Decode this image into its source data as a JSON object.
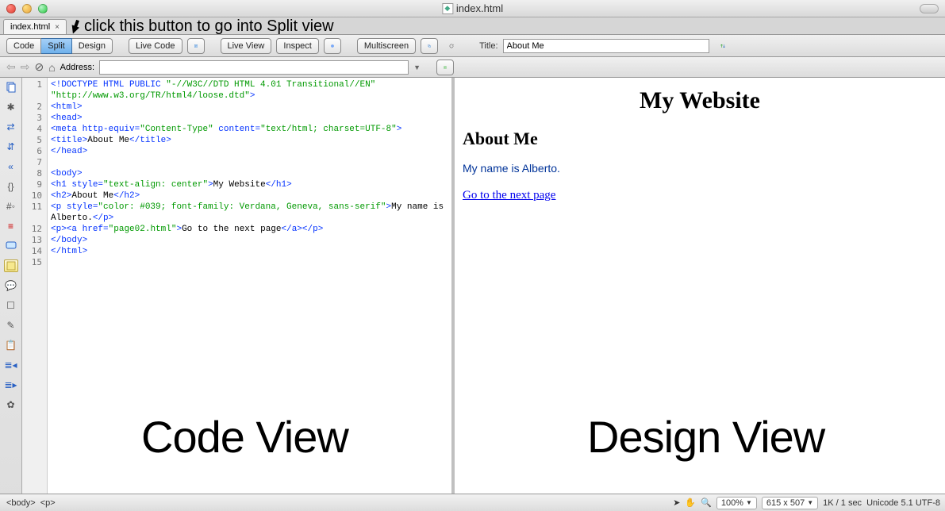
{
  "window": {
    "title": "index.html"
  },
  "tab": {
    "name": "index.html"
  },
  "annotation": {
    "text": "click this button to go into Split view"
  },
  "toolbar": {
    "view_buttons": {
      "code": "Code",
      "split": "Split",
      "design": "Design"
    },
    "live_code": "Live Code",
    "live_view": "Live View",
    "inspect": "Inspect",
    "multiscreen": "Multiscreen",
    "title_label": "Title:",
    "title_value": "About Me"
  },
  "address_bar": {
    "label": "Address:",
    "value": ""
  },
  "code": {
    "lines": [
      {
        "n": "1",
        "html": "<span class='c-tag'>&lt;!DOCTYPE HTML PUBLIC </span><span class='c-val'>\"-//W3C//DTD HTML 4.01 Transitional//EN\"</span>"
      },
      {
        "n": "",
        "html": "<span class='c-val'>\"http://www.w3.org/TR/html4/loose.dtd\"</span><span class='c-tag'>&gt;</span>"
      },
      {
        "n": "2",
        "html": "<span class='c-tag'>&lt;html&gt;</span>"
      },
      {
        "n": "3",
        "html": "<span class='c-tag'>&lt;head&gt;</span>"
      },
      {
        "n": "4",
        "html": "<span class='c-tag'>&lt;meta</span> <span class='c-attr'>http-equiv=</span><span class='c-val'>\"Content-Type\"</span> <span class='c-attr'>content=</span><span class='c-val'>\"text/html; charset=UTF-8\"</span><span class='c-tag'>&gt;</span>"
      },
      {
        "n": "5",
        "html": "<span class='c-tag'>&lt;title&gt;</span>About Me<span class='c-tag'>&lt;/title&gt;</span>"
      },
      {
        "n": "6",
        "html": "<span class='c-tag'>&lt;/head&gt;</span>"
      },
      {
        "n": "7",
        "html": ""
      },
      {
        "n": "8",
        "html": "<span class='c-tag'>&lt;body&gt;</span>"
      },
      {
        "n": "9",
        "html": "<span class='c-tag'>&lt;h1</span> <span class='c-attr'>style=</span><span class='c-val'>\"text-align: center\"</span><span class='c-tag'>&gt;</span>My Website<span class='c-tag'>&lt;/h1&gt;</span>"
      },
      {
        "n": "10",
        "html": "<span class='c-tag'>&lt;h2&gt;</span>About Me<span class='c-tag'>&lt;/h2&gt;</span>"
      },
      {
        "n": "11",
        "html": "<span class='c-tag'>&lt;p</span> <span class='c-attr'>style=</span><span class='c-val'>\"color: #039; font-family: Verdana, Geneva, sans-serif\"</span><span class='c-tag'>&gt;</span>My name is"
      },
      {
        "n": "",
        "html": "Alberto.<span class='c-tag'>&lt;/p&gt;</span>"
      },
      {
        "n": "12",
        "html": "<span class='c-tag'>&lt;p&gt;&lt;a</span> <span class='c-attr'>href=</span><span class='c-val'>\"page02.html\"</span><span class='c-tag'>&gt;</span>Go to the next page<span class='c-tag'>&lt;/a&gt;&lt;/p&gt;</span>"
      },
      {
        "n": "13",
        "html": "<span class='c-tag'>&lt;/body&gt;</span>"
      },
      {
        "n": "14",
        "html": "<span class='c-tag'>&lt;/html&gt;</span>"
      },
      {
        "n": "15",
        "html": ""
      }
    ]
  },
  "design": {
    "h1": "My Website",
    "h2": "About Me",
    "p1": "My name is Alberto.",
    "link": "Go to the next page"
  },
  "overlays": {
    "code_view": "Code View",
    "design_view": "Design View"
  },
  "status": {
    "crumbs": [
      "<body>",
      "<p>"
    ],
    "zoom": "100%",
    "dims": "615 x 507",
    "size": "1K / 1 sec",
    "encoding": "Unicode 5.1 UTF-8"
  }
}
